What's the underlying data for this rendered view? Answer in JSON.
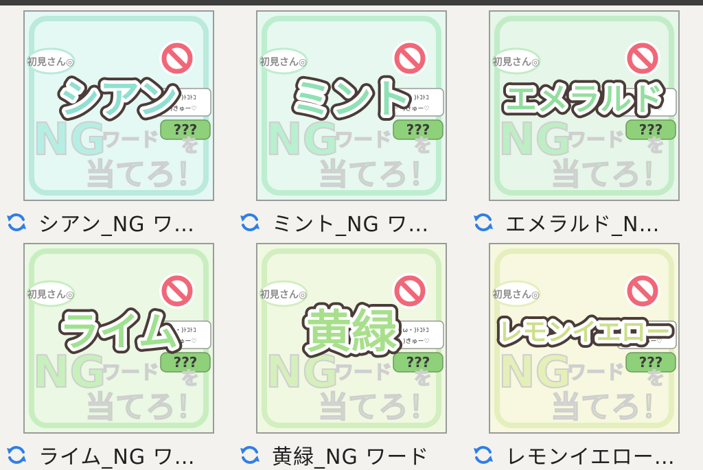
{
  "files": [
    {
      "name": "シアン_NG ワ…",
      "overlay": "シアン",
      "colors": {
        "bg": "#e4f8f4",
        "frame": "#b9eadb",
        "text": "#8fe0d0",
        "ng": "#b5efe4"
      },
      "icon": "sync-icon"
    },
    {
      "name": "ミント_NG ワ…",
      "overlay": "ミント",
      "colors": {
        "bg": "#e6f8ef",
        "frame": "#bdeecf",
        "text": "#8fe1b4",
        "ng": "#b8f0d0"
      },
      "icon": "sync-icon"
    },
    {
      "name": "エメラルド_N…",
      "overlay": "エメラルド",
      "colors": {
        "bg": "#e6f6e8",
        "frame": "#c1ecc7",
        "text": "#93de9f",
        "ng": "#bdeec4"
      },
      "icon": "sync-icon"
    },
    {
      "name": "ライム_NG ワ…",
      "overlay": "ライム",
      "colors": {
        "bg": "#eaf8e4",
        "frame": "#c8eec0",
        "text": "#9ee28f",
        "ng": "#c8f0bd"
      },
      "icon": "sync-icon"
    },
    {
      "name": "黄緑_NG ワード",
      "overlay": "黄緑",
      "colors": {
        "bg": "#f0f8e2",
        "frame": "#d3eebf",
        "text": "#a8df8c",
        "ng": "#d5f0bb"
      },
      "icon": "sync-icon"
    },
    {
      "name": "レモンイエロー…",
      "overlay": "レモンイエロー",
      "colors": {
        "bg": "#f7f8df",
        "frame": "#e5efbd",
        "text": "#cddf8a",
        "ng": "#e5efb8"
      },
      "icon": "sync-icon"
    }
  ],
  "thumbnail_art": {
    "badge": "初見さん◎",
    "chat1": "(*´・ω・)ﾄｺﾄｺ",
    "chat2": "( ˊᵕˋ )きゅー♡",
    "bubble": "???",
    "ng": "NG",
    "word": "ワード",
    "wo": "を",
    "bottom": "当てろ！"
  },
  "accent": {
    "sync": "#2f7fe6",
    "no_sign": "#f06878"
  }
}
